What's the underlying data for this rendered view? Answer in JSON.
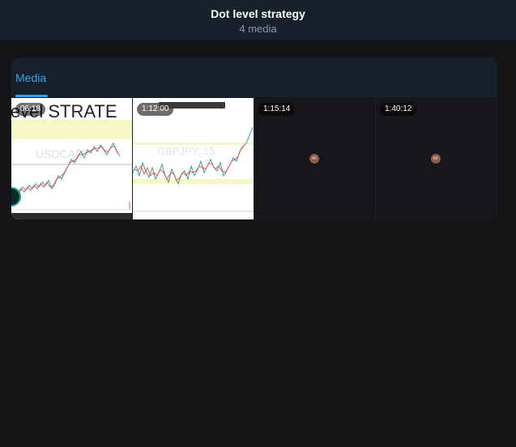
{
  "header": {
    "title": "Dot level strategy",
    "subtitle": "4 media"
  },
  "tabs": [
    {
      "label": "Media",
      "active": true
    }
  ],
  "media": [
    {
      "duration": "06:18",
      "thumbnail": "strategy-chart-thumbnail",
      "overlay_text": "level STRATE",
      "chart_label": "USDCAD"
    },
    {
      "duration": "1:12:00",
      "thumbnail": "chart-thumbnail",
      "chart_label": "GBPJPY, 15"
    },
    {
      "duration": "1:15:14",
      "thumbnail": "dark-avatar-thumbnail",
      "avatar_initials": "AK"
    },
    {
      "duration": "1:40:12",
      "thumbnail": "dark-avatar-thumbnail",
      "avatar_initials": "AK"
    }
  ],
  "colors": {
    "background": "#151517",
    "header_bg": "#17212b",
    "panel_bg": "#17212b",
    "accent": "#3ba5ea",
    "highlight_band": "#f7f7c4"
  }
}
